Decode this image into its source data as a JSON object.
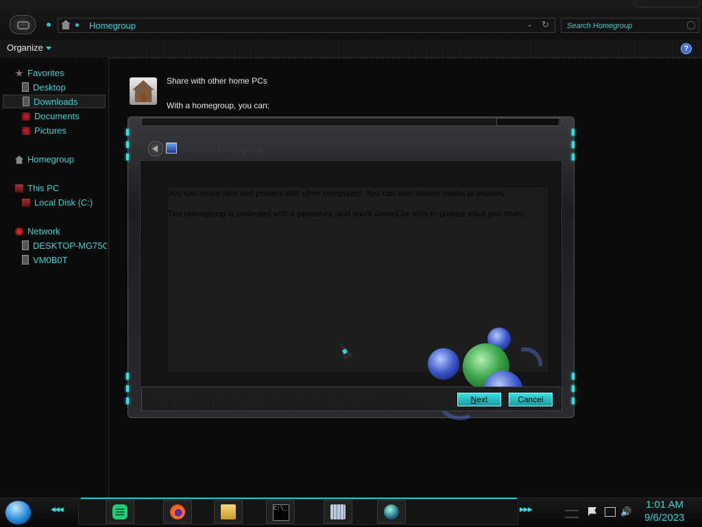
{
  "address_bar": {
    "location": "Homegroup"
  },
  "search": {
    "placeholder": "Search Homegroup"
  },
  "toolbar": {
    "organize_label": "Organize",
    "help_label": "?"
  },
  "sidebar": {
    "favorites": {
      "label": "Favorites",
      "items": [
        "Desktop",
        "Downloads",
        "Documents",
        "Pictures"
      ]
    },
    "homegroup": {
      "label": "Homegroup"
    },
    "this_pc": {
      "label": "This PC",
      "items": [
        "Local Disk (C:)"
      ]
    },
    "network": {
      "label": "Network",
      "items": [
        "DESKTOP-MG75C",
        "VM0B0T"
      ]
    }
  },
  "content": {
    "title": "Share with other home PCs",
    "subtitle": "With a homegroup, you can:"
  },
  "dialog": {
    "title": "Create a Homegroup",
    "body_line1": "You can share files and printers with other computers. You can also stream media to devices.",
    "body_line2": "The homegroup is protected with a password, and you'll always be able to choose what you share.",
    "next_accel": "N",
    "next_rest": "ext",
    "cancel_label": "Cancel"
  },
  "taskbar": {
    "apps": [
      "notes-app",
      "firefox",
      "file-explorer",
      "command-prompt",
      "calculator",
      "internet-explorer"
    ],
    "clock_time": "1:01 AM",
    "clock_date": "9/6/2023",
    "accent_color": "#22c8d0"
  }
}
